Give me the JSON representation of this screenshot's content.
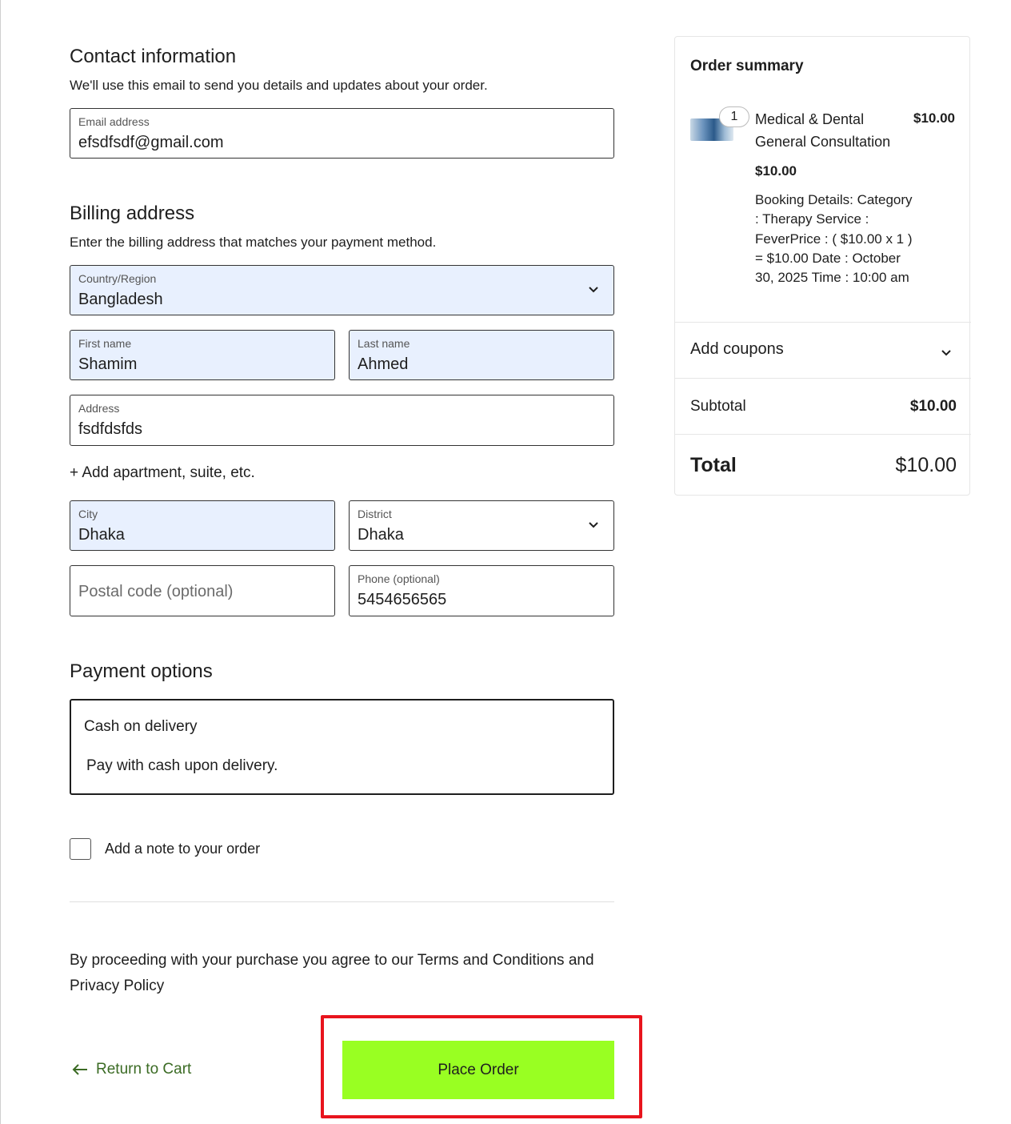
{
  "contact": {
    "title": "Contact information",
    "description": "We'll use this email to send you details and updates about your order.",
    "email_label": "Email address",
    "email_value": "efsdfsdf@gmail.com"
  },
  "billing": {
    "title": "Billing address",
    "description": "Enter the billing address that matches your payment method.",
    "country_label": "Country/Region",
    "country_value": "Bangladesh",
    "first_name_label": "First name",
    "first_name_value": "Shamim",
    "last_name_label": "Last name",
    "last_name_value": "Ahmed",
    "address_label": "Address",
    "address_value": "fsdfdsfds",
    "add_apartment": "+ Add apartment, suite, etc.",
    "city_label": "City",
    "city_value": "Dhaka",
    "district_label": "District",
    "district_value": "Dhaka",
    "postal_placeholder": "Postal code (optional)",
    "phone_label": "Phone (optional)",
    "phone_value": "5454656565"
  },
  "payment": {
    "title": "Payment options",
    "method": "Cash on delivery",
    "method_description": "Pay with cash upon delivery."
  },
  "note": {
    "label": "Add a note to your order",
    "checked": false
  },
  "terms": "By proceeding with your purchase you agree to our Terms and Conditions and Privacy Policy",
  "actions": {
    "return_label": "Return to Cart",
    "place_order_label": "Place Order"
  },
  "summary": {
    "title": "Order summary",
    "item": {
      "quantity": "1",
      "name": "Medical & Dental General Consultation",
      "price": "$10.00",
      "unit_price": "$10.00",
      "booking_details": "Booking Details: Category : Therapy Service : FeverPrice : ( $10.00 x 1 ) = $10.00 Date : October 30, 2025 Time : 10:00 am"
    },
    "coupons_label": "Add coupons",
    "subtotal_label": "Subtotal",
    "subtotal_value": "$10.00",
    "total_label": "Total",
    "total_value": "$10.00"
  },
  "colors": {
    "place_order_bg": "#99ff22",
    "highlight_border": "#e8141d",
    "return_link": "#3b6b24",
    "autofill_bg": "#e8f0fe"
  }
}
